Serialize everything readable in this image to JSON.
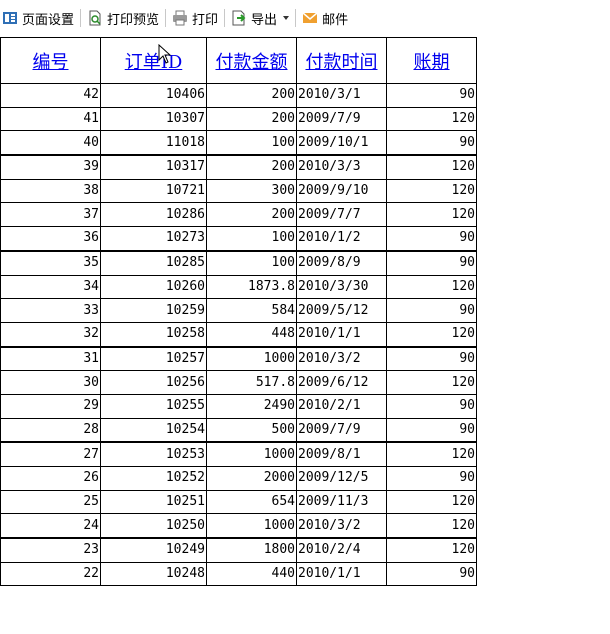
{
  "toolbar": {
    "page_setup": "页面设置",
    "print_preview": "打印预览",
    "print": "打印",
    "export": "导出",
    "mail": "邮件"
  },
  "table": {
    "headers": [
      "编号",
      "订单ID",
      "付款金额",
      "付款时间",
      "账期"
    ],
    "rows": [
      [
        "42",
        "10406",
        "200",
        "2010/3/1",
        "90"
      ],
      [
        "41",
        "10307",
        "200",
        "2009/7/9",
        "120"
      ],
      [
        "40",
        "11018",
        "100",
        "2009/10/1",
        "90"
      ],
      [
        "39",
        "10317",
        "200",
        "2010/3/3",
        "120"
      ],
      [
        "38",
        "10721",
        "300",
        "2009/9/10",
        "120"
      ],
      [
        "37",
        "10286",
        "200",
        "2009/7/7",
        "120"
      ],
      [
        "36",
        "10273",
        "100",
        "2010/1/2",
        "90"
      ],
      [
        "35",
        "10285",
        "100",
        "2009/8/9",
        "90"
      ],
      [
        "34",
        "10260",
        "1873.8",
        "2010/3/30",
        "120"
      ],
      [
        "33",
        "10259",
        "584",
        "2009/5/12",
        "90"
      ],
      [
        "32",
        "10258",
        "448",
        "2010/1/1",
        "120"
      ],
      [
        "31",
        "10257",
        "1000",
        "2010/3/2",
        "90"
      ],
      [
        "30",
        "10256",
        "517.8",
        "2009/6/12",
        "120"
      ],
      [
        "29",
        "10255",
        "2490",
        "2010/2/1",
        "90"
      ],
      [
        "28",
        "10254",
        "500",
        "2009/7/9",
        "90"
      ],
      [
        "27",
        "10253",
        "1000",
        "2009/8/1",
        "120"
      ],
      [
        "26",
        "10252",
        "2000",
        "2009/12/5",
        "90"
      ],
      [
        "25",
        "10251",
        "654",
        "2009/11/3",
        "120"
      ],
      [
        "24",
        "10250",
        "1000",
        "2010/3/2",
        "120"
      ],
      [
        "23",
        "10249",
        "1800",
        "2010/2/4",
        "120"
      ],
      [
        "22",
        "10248",
        "440",
        "2010/1/1",
        "90"
      ]
    ]
  },
  "colors": {
    "link": "#0000ee",
    "mail_icon": "#f0a030",
    "page_icon": "#2f6fb5"
  }
}
